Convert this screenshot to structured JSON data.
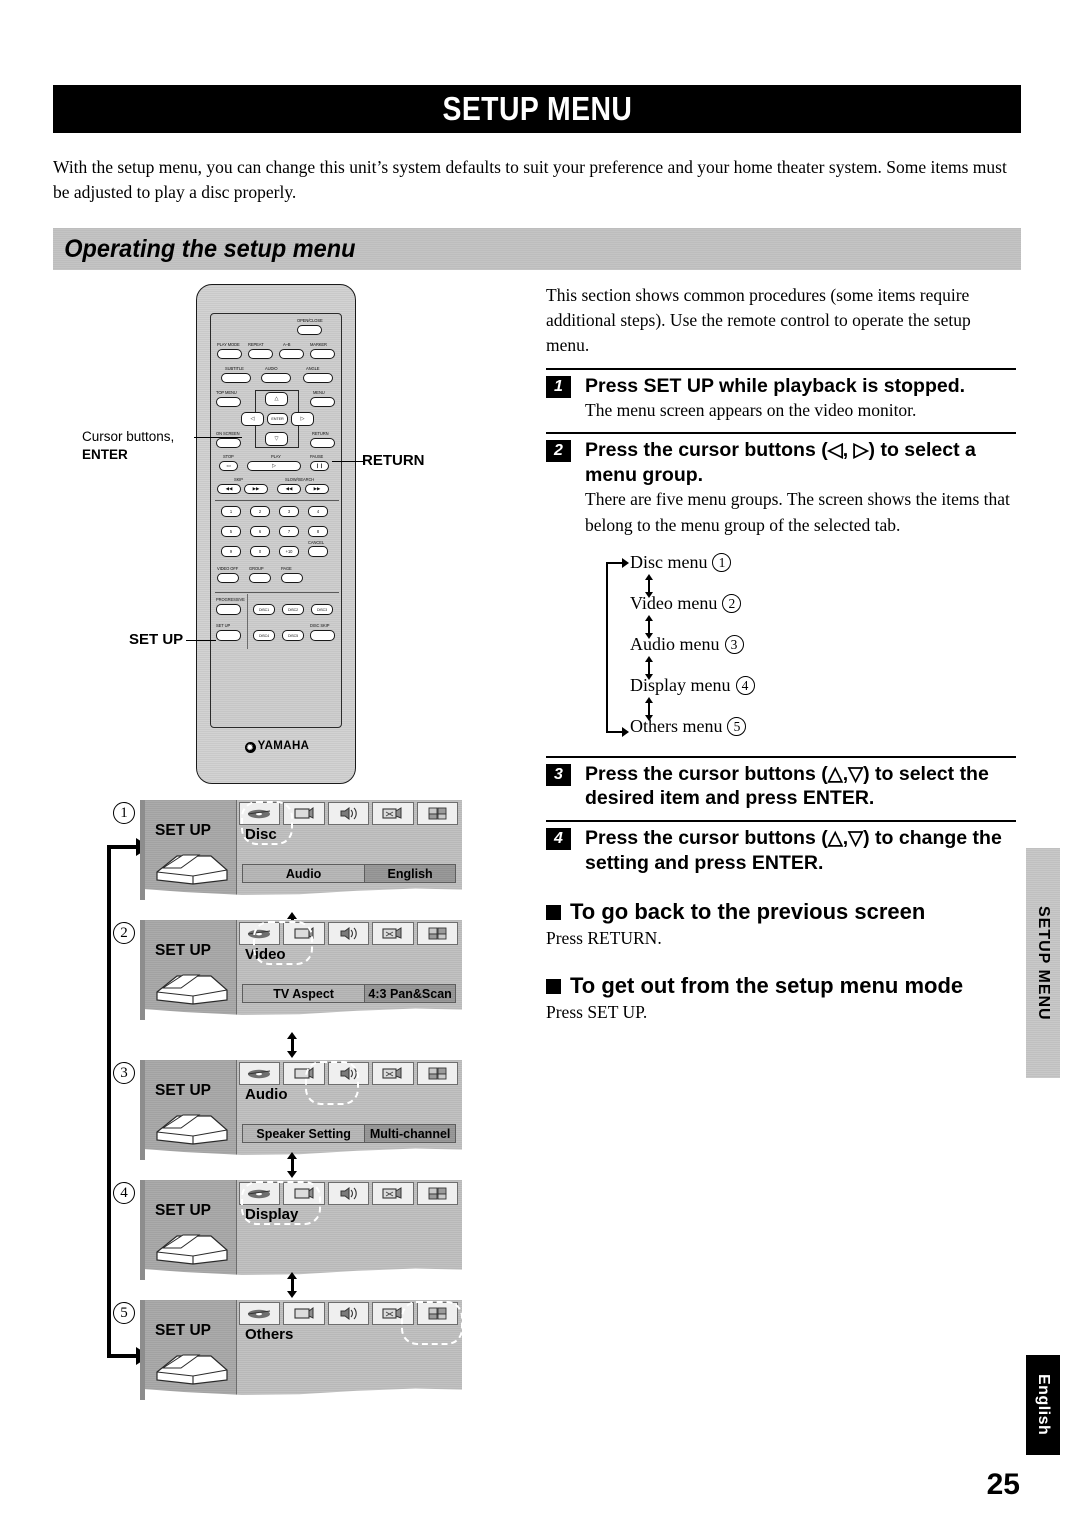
{
  "header": {
    "title": "SETUP MENU"
  },
  "intro": "With the setup menu, you can change this unit’s system defaults to suit your preference and your home theater system. Some items must be adjusted to play a disc properly.",
  "section": {
    "band_title": "Operating the setup menu"
  },
  "right_column": {
    "lead": "This section shows common procedures (some items require additional steps). Use the remote control to operate the setup menu.",
    "steps": [
      {
        "num": "1",
        "heading": "Press SET UP while playback is stopped.",
        "body": "The menu screen appears on the video monitor."
      },
      {
        "num": "2",
        "heading": "Press the cursor buttons (◁, ▷) to select a menu group.",
        "body": "There are five menu groups. The screen shows the items that belong to the menu group of the selected tab."
      },
      {
        "num": "3",
        "heading": "Press the cursor buttons (△,▽) to select the desired item and press ENTER.",
        "body": ""
      },
      {
        "num": "4",
        "heading": "Press the cursor buttons (△,▽) to change the setting and press ENTER.",
        "body": ""
      }
    ],
    "menu_chain": [
      {
        "label": "Disc menu",
        "index": "1"
      },
      {
        "label": "Video menu",
        "index": "2"
      },
      {
        "label": "Audio menu",
        "index": "3"
      },
      {
        "label": "Display menu",
        "index": "4"
      },
      {
        "label": "Others menu",
        "index": "5"
      }
    ],
    "notes": [
      {
        "heading": "To go back to the previous screen",
        "body": "Press RETURN."
      },
      {
        "heading": "To get out from the setup menu mode",
        "body": "Press SET UP."
      }
    ]
  },
  "remote": {
    "brand": "YAMAHA",
    "brand_mark": "✹",
    "callouts": {
      "cursor_line1": "Cursor buttons,",
      "cursor_line2": "ENTER",
      "return": "RETURN",
      "setup": "SET UP"
    },
    "labels": {
      "open_close": "OPEN/CLOSE",
      "play_mode": "PLAY MODE",
      "repeat": "REPEAT",
      "ab": "A–B",
      "marker": "MARKER",
      "subtitle": "SUBTITLE",
      "audio": "AUDIO",
      "angle": "ANGLE",
      "top_menu": "TOP MENU",
      "menu": "MENU",
      "on_screen": "ON SCREEN",
      "return": "RETURN",
      "enter": "ENTER",
      "stop": "STOP",
      "play": "PLAY",
      "pause": "PAUSE",
      "skip": "SKIP",
      "slow_search": "SLOW/SEARCH",
      "cancel": "CANCEL",
      "video_off": "VIDEO OFF",
      "group": "GROUP",
      "page": "PAGE",
      "progressive": "PROGRESSIVE",
      "set_up": "SET UP",
      "disc_skip": "DISC SKIP"
    },
    "numpad": [
      "1",
      "2",
      "3",
      "4",
      "5",
      "6",
      "7",
      "8",
      "9",
      "0",
      "+10"
    ],
    "disc_buttons": [
      "DISC1",
      "DISC2",
      "DISC3",
      "DISC4",
      "DISC5"
    ],
    "dpad": {
      "up": "△",
      "down": "▽",
      "left": "◁",
      "right": "▷"
    }
  },
  "mockups": [
    {
      "index": "1",
      "setup_label": "SET UP",
      "group": "Disc",
      "selected_tab": 0,
      "item_key": "Audio",
      "item_value": "English"
    },
    {
      "index": "2",
      "setup_label": "SET UP",
      "group": "Video",
      "selected_tab": 1,
      "item_key": "TV Aspect",
      "item_value": "4:3 Pan&Scan"
    },
    {
      "index": "3",
      "setup_label": "SET UP",
      "group": "Audio",
      "selected_tab": 2,
      "item_key": "Speaker Setting",
      "item_value": "Multi-channel"
    },
    {
      "index": "4",
      "setup_label": "SET UP",
      "group": "Display",
      "selected_tab": 3,
      "item_key": "",
      "item_value": ""
    },
    {
      "index": "5",
      "setup_label": "SET UP",
      "group": "Others",
      "selected_tab": 4,
      "item_key": "",
      "item_value": ""
    }
  ],
  "side_tabs": {
    "top": "SETUP MENU",
    "bottom": "English"
  },
  "page_number": "25",
  "colors": {
    "ink": "#000000",
    "band": "#c2c2c2",
    "paper": "#ffffff"
  }
}
